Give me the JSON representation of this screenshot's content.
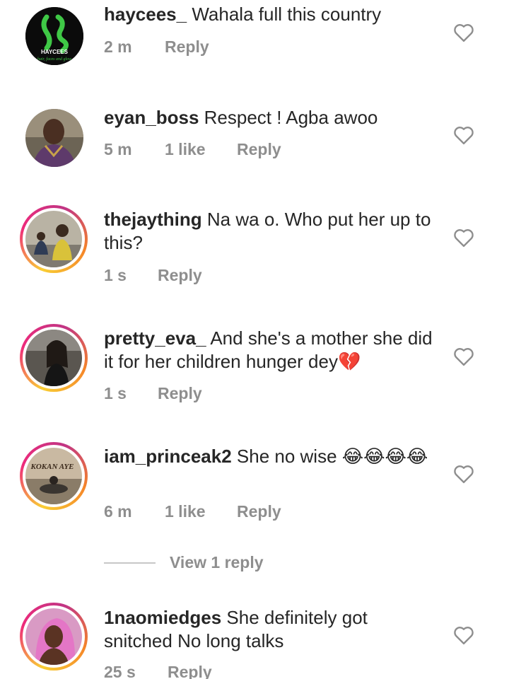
{
  "comments": [
    {
      "username": "haycees_",
      "text": "Wahala full this country",
      "time": "2 m",
      "likes": "",
      "reply": "Reply",
      "avatar_label": "HAYCEES",
      "avatar_sub": "hair, faces and glow"
    },
    {
      "username": "eyan_boss",
      "text": "Respect ! Agba awoo",
      "time": "5 m",
      "likes": "1 like",
      "reply": "Reply"
    },
    {
      "username": "thejaything",
      "text": "Na wa o. Who put her up to this?",
      "time": "1 s",
      "likes": "",
      "reply": "Reply"
    },
    {
      "username": "pretty_eva_",
      "text": "And she's a mother she did it for her children hunger dey💔",
      "time": "1 s",
      "likes": "",
      "reply": "Reply"
    },
    {
      "username": "iam_princeak2",
      "text": "She no wise 😂😂😂😂",
      "time": "6 m",
      "likes": "1 like",
      "reply": "Reply",
      "avatar_label": "KOKAN AYE"
    },
    {
      "username": "1naomiedges",
      "text": "She definitely got snitched No long talks",
      "time": "25 s",
      "likes": "",
      "reply": "Reply"
    }
  ],
  "view_replies_label": "View 1 reply",
  "icons": {
    "like": "heart-outline-icon"
  },
  "colors": {
    "text": "#262626",
    "secondary": "#8e8e8e",
    "story_ring": "#ee2a7b"
  }
}
